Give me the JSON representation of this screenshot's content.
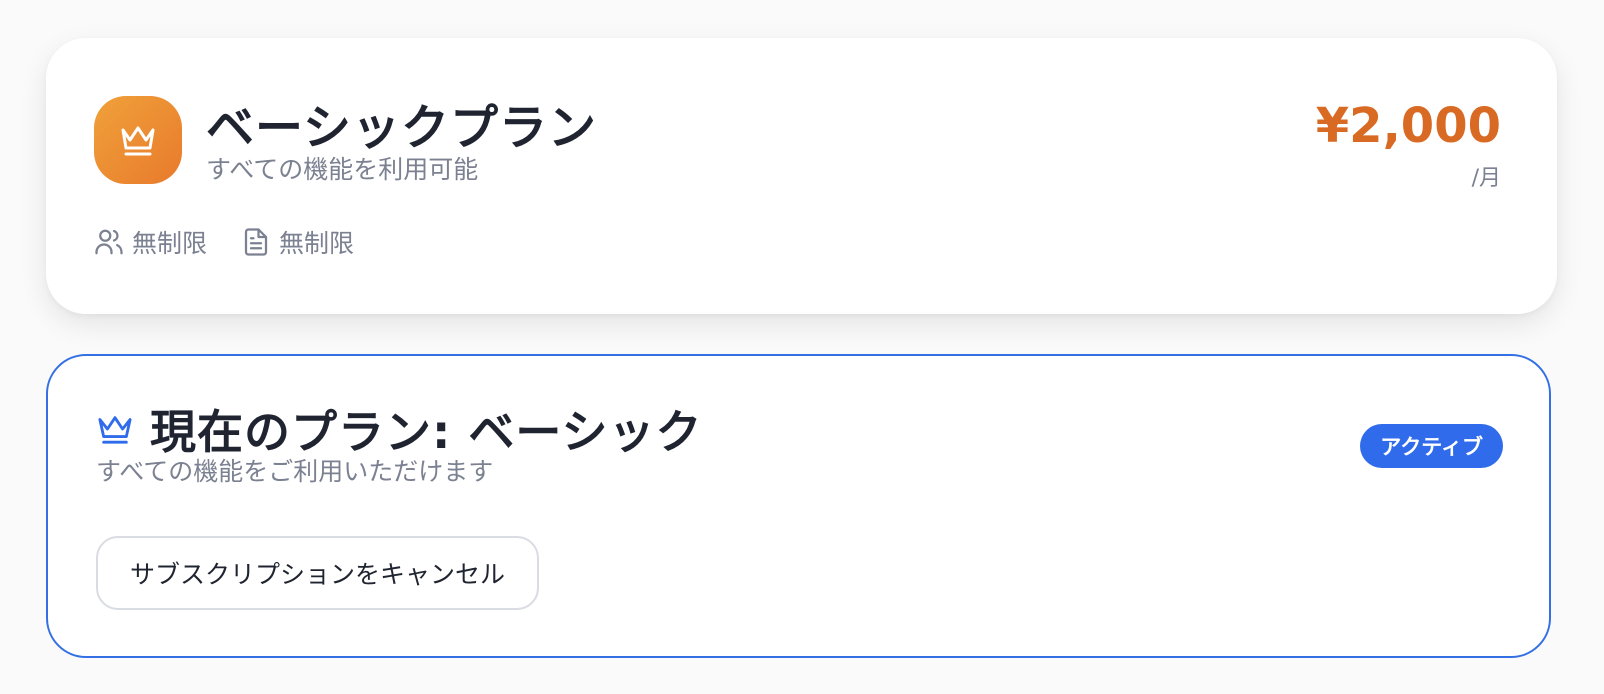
{
  "plan_card": {
    "icon": "crown-icon",
    "title": "ベーシックプラン",
    "subtitle": "すべての機能を利用可能",
    "price": "¥2,000",
    "period": "/月",
    "features": [
      {
        "icon": "users-icon",
        "label": "無制限"
      },
      {
        "icon": "document-icon",
        "label": "無制限"
      }
    ],
    "accent_color": "#e87a2c"
  },
  "current_plan": {
    "icon": "crown-icon",
    "title": "現在のプラン: ベーシック",
    "subtitle": "すべての機能をご利用いただけます",
    "status_badge": "アクティブ",
    "cancel_button_label": "サブスクリプションをキャンセル",
    "accent_color": "#2f6bea"
  }
}
